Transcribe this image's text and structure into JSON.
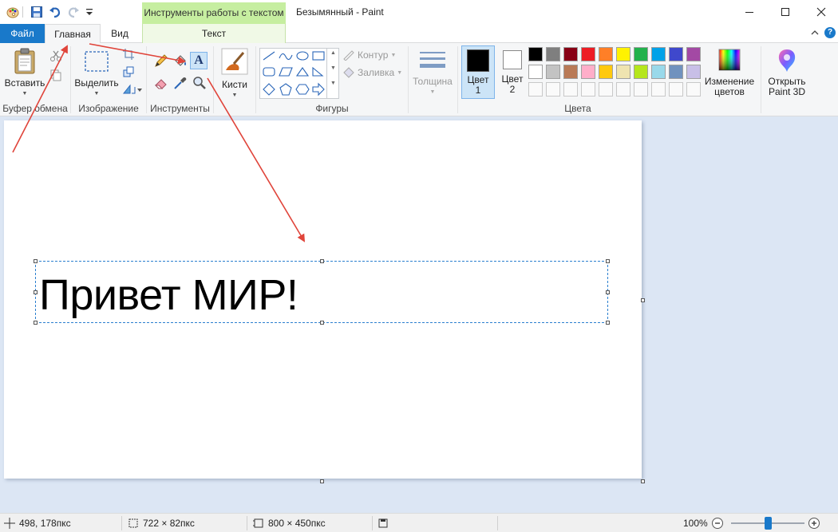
{
  "app": {
    "title": "Безымянный - Paint",
    "context_tab_header": "Инструменты работы с текстом"
  },
  "tabs": {
    "file": "Файл",
    "home": "Главная",
    "view": "Вид",
    "text": "Текст"
  },
  "ribbon": {
    "clipboard": {
      "paste": "Вставить",
      "label": "Буфер обмена"
    },
    "image": {
      "select": "Выделить",
      "label": "Изображение"
    },
    "tools": {
      "label": "Инструменты"
    },
    "brushes": {
      "label": "Кисти"
    },
    "shapes": {
      "outline": "Контур",
      "fill": "Заливка",
      "label": "Фигуры"
    },
    "size": {
      "label": "Толщина"
    },
    "colors": {
      "color1_line1": "Цвет",
      "color1_line2": "1",
      "color2_line1": "Цвет",
      "color2_line2": "2",
      "label": "Цвета",
      "edit_line1": "Изменение",
      "edit_line2": "цветов",
      "palette_row1": [
        "#000000",
        "#7f7f7f",
        "#880015",
        "#ed1c24",
        "#ff7f27",
        "#fff200",
        "#22b14c",
        "#00a2e8",
        "#3f48cc",
        "#a349a4"
      ],
      "palette_row2": [
        "#ffffff",
        "#c3c3c3",
        "#b97a57",
        "#ffaec9",
        "#ffc90e",
        "#efe4b0",
        "#b5e61d",
        "#99d9ea",
        "#7092be",
        "#c8bfe7"
      ]
    },
    "paint3d": {
      "line1": "Открыть",
      "line2": "Paint 3D"
    }
  },
  "canvas": {
    "text": "Привет МИР!"
  },
  "status": {
    "cursor": "498, 178пкс",
    "selection": "722 × 82пкс",
    "canvas_size": "800 × 450пкс",
    "zoom": "100%",
    "zoom_level": 0.5
  },
  "colors": {
    "accent_file_tab": "#1979ca",
    "context_tab": "#c6eea0",
    "arrow": "#e0443a",
    "selection_border": "#2a7fcf"
  }
}
